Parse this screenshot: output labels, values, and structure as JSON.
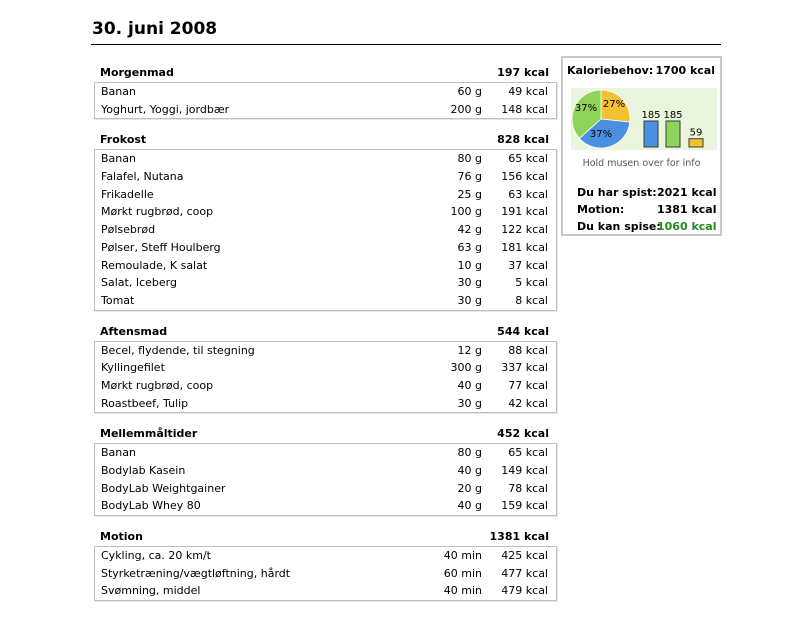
{
  "date_title": "30. juni 2008",
  "sections": [
    {
      "name": "Morgenmad",
      "total": "197 kcal",
      "items": [
        {
          "name": "Banan",
          "qty": "60 g",
          "kcal": "49 kcal"
        },
        {
          "name": "Yoghurt, Yoggi, jordbær",
          "qty": "200 g",
          "kcal": "148 kcal"
        }
      ]
    },
    {
      "name": "Frokost",
      "total": "828 kcal",
      "items": [
        {
          "name": "Banan",
          "qty": "80 g",
          "kcal": "65 kcal"
        },
        {
          "name": "Falafel, Nutana",
          "qty": "76 g",
          "kcal": "156 kcal"
        },
        {
          "name": "Frikadelle",
          "qty": "25 g",
          "kcal": "63 kcal"
        },
        {
          "name": "Mørkt rugbrød, coop",
          "qty": "100 g",
          "kcal": "191 kcal"
        },
        {
          "name": "Pølsebrød",
          "qty": "42 g",
          "kcal": "122 kcal"
        },
        {
          "name": "Pølser, Steff Houlberg",
          "qty": "63 g",
          "kcal": "181 kcal"
        },
        {
          "name": "Remoulade, K salat",
          "qty": "10 g",
          "kcal": "37 kcal"
        },
        {
          "name": "Salat, Iceberg",
          "qty": "30 g",
          "kcal": "5 kcal"
        },
        {
          "name": "Tomat",
          "qty": "30 g",
          "kcal": "8 kcal"
        }
      ]
    },
    {
      "name": "Aftensmad",
      "total": "544 kcal",
      "items": [
        {
          "name": "Becel, flydende, til stegning",
          "qty": "12 g",
          "kcal": "88 kcal"
        },
        {
          "name": "Kyllingefilet",
          "qty": "300 g",
          "kcal": "337 kcal"
        },
        {
          "name": "Mørkt rugbrød, coop",
          "qty": "40 g",
          "kcal": "77 kcal"
        },
        {
          "name": "Roastbeef, Tulip",
          "qty": "30 g",
          "kcal": "42 kcal"
        }
      ]
    },
    {
      "name": "Mellemmåltider",
      "total": "452 kcal",
      "items": [
        {
          "name": "Banan",
          "qty": "80 g",
          "kcal": "65 kcal"
        },
        {
          "name": "Bodylab Kasein",
          "qty": "40 g",
          "kcal": "149 kcal"
        },
        {
          "name": "BodyLab Weightgainer",
          "qty": "20 g",
          "kcal": "78 kcal"
        },
        {
          "name": "BodyLab Whey 80",
          "qty": "40 g",
          "kcal": "159 kcal"
        }
      ]
    },
    {
      "name": "Motion",
      "total": "1381 kcal",
      "items": [
        {
          "name": "Cykling, ca. 20 km/t",
          "qty": "40 min",
          "kcal": "425 kcal"
        },
        {
          "name": "Styrketræning/vægtløftning, hårdt",
          "qty": "60 min",
          "kcal": "477 kcal"
        },
        {
          "name": "Svømning, middel",
          "qty": "40 min",
          "kcal": "479 kcal"
        }
      ]
    }
  ],
  "summary": {
    "label": "Kaloriebehov:",
    "value": "1700 kcal",
    "pie": {
      "slices": [
        {
          "label": "27%",
          "value": 27,
          "color": "#f2c132"
        },
        {
          "label": "37%",
          "value": 37,
          "color": "#4a8fe0"
        },
        {
          "label": "37%",
          "value": 37,
          "color": "#8fd45a"
        }
      ]
    },
    "bars": [
      {
        "label": "185",
        "value": 185,
        "color": "#4a8fe0"
      },
      {
        "label": "185",
        "value": 185,
        "color": "#8fd45a"
      },
      {
        "label": "59",
        "value": 59,
        "color": "#f2c132"
      }
    ],
    "hint": "Hold musen over for info",
    "eaten_label": "Du har spist:",
    "eaten_value": "2021 kcal",
    "exercise_label": "Motion:",
    "exercise_value": "1381 kcal",
    "remaining_label": "Du kan spise:",
    "remaining_value": "1060 kcal",
    "remaining_color": "#1f8a1f"
  }
}
